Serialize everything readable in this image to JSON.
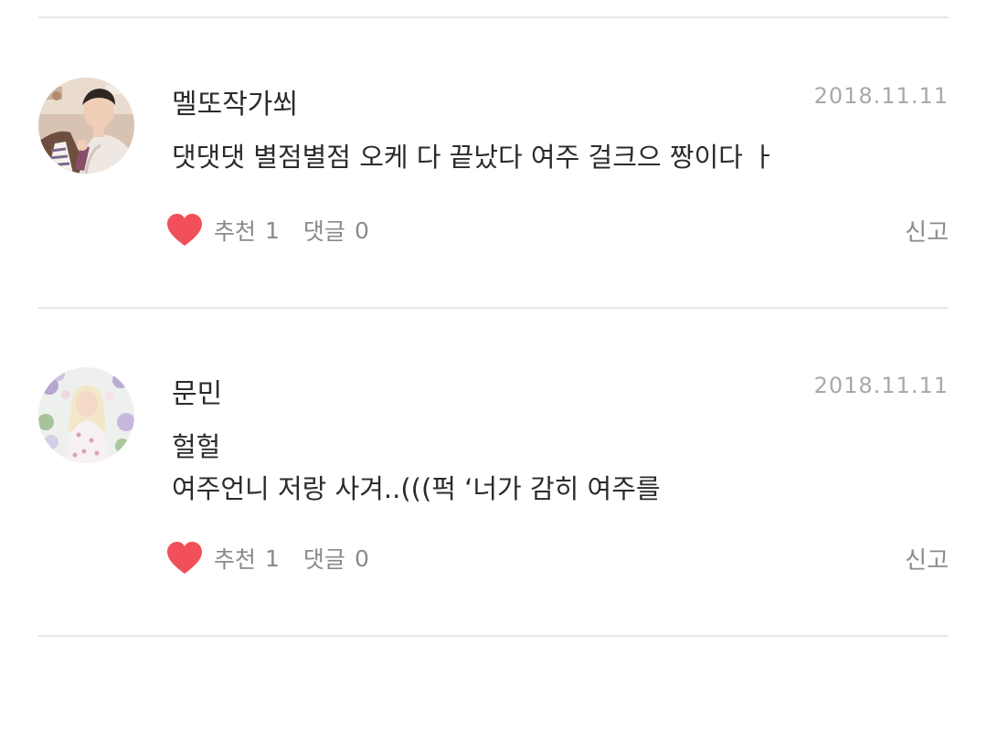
{
  "colors": {
    "heart": "#f1505a",
    "divider": "#e6e6e6",
    "muted_text": "#8a8a8a",
    "date_text": "#a9a9a9"
  },
  "comments": [
    {
      "author": "멜또작가쐬",
      "date": "2018.11.11",
      "text_lines": [
        "댓댓댓 별점별점 오케 다 끝났다 여주 걸크으 짱이다 ㅏ"
      ],
      "recommend_label": "추천",
      "recommend_count": "1",
      "reply_label": "댓글",
      "reply_count": "0",
      "report_label": "신고",
      "like_icon": "heart-icon"
    },
    {
      "author": "문민",
      "date": "2018.11.11",
      "text_lines": [
        "헐헐",
        "여주언니 저랑 사겨..(((퍽 ‘너가 감히 여주를"
      ],
      "recommend_label": "추천",
      "recommend_count": "1",
      "reply_label": "댓글",
      "reply_count": "0",
      "report_label": "신고",
      "like_icon": "heart-icon"
    }
  ]
}
